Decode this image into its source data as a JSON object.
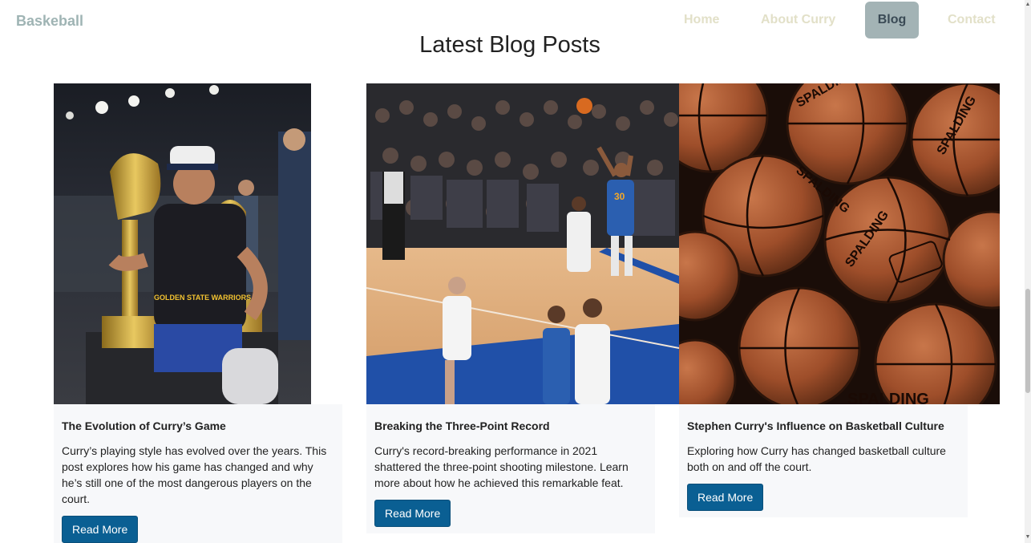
{
  "nav": {
    "brand": "Baskeball",
    "items": [
      "Home",
      "About Curry",
      "Blog",
      "Contact"
    ],
    "active": "Blog"
  },
  "section": {
    "title": "Latest Blog Posts"
  },
  "posts": [
    {
      "title": "The Evolution of Curry’s Game",
      "text": "Curry’s playing style has evolved over the years. This post explores how his game has changed and why he’s still one of the most dangerous players on the court.",
      "button": "Read More",
      "image": "curry-trophies-photo"
    },
    {
      "title": "Breaking the Three-Point Record",
      "text": "Curry's record-breaking performance in 2021 shattered the three-point shooting milestone. Learn more about how he achieved this remarkable feat.",
      "button": "Read More",
      "image": "three-point-shot-photo"
    },
    {
      "title": "Stephen Curry's Influence on Basketball Culture",
      "text": "Exploring how Curry has changed basketball culture both on and off the court.",
      "button": "Read More",
      "image": "basketballs-photo"
    }
  ],
  "photo_labels": {
    "shirt": "GOLDEN STATE WARRIORS",
    "jersey_number": "30",
    "ball_brand": "SPALDING"
  },
  "colors": {
    "accent": "#0a5f93",
    "nav_active_bg": "#a3b3b5",
    "brand": "#9fb4b4",
    "nav_inactive": "#e2e0c8",
    "card_body_bg": "#f7f8fa"
  }
}
